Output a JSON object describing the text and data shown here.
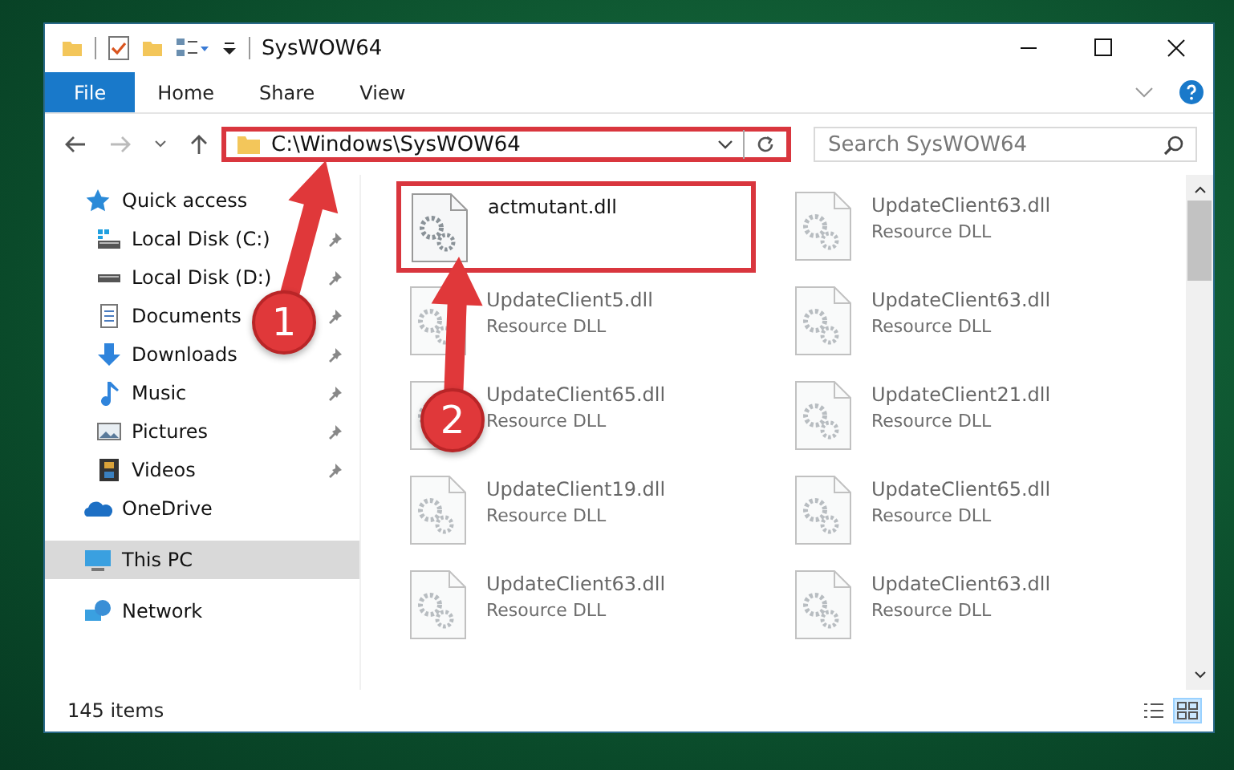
{
  "window": {
    "title": "SysWOW64"
  },
  "ribbon_tabs": [
    {
      "label": "File",
      "selected": true
    },
    {
      "label": "Home",
      "selected": false
    },
    {
      "label": "Share",
      "selected": false
    },
    {
      "label": "View",
      "selected": false
    }
  ],
  "address_bar": {
    "path": "C:\\Windows\\SysWOW64",
    "highlighted": true
  },
  "search": {
    "placeholder": "Search SysWOW64"
  },
  "nav_pane": [
    {
      "label": "Quick access",
      "kind": "quick-access",
      "selected": false,
      "children": [
        {
          "label": "Local Disk (C:)",
          "kind": "disk-c",
          "pinned": true,
          "selected": false
        },
        {
          "label": "Local Disk (D:)",
          "kind": "disk",
          "pinned": true,
          "selected": false
        },
        {
          "label": "Documents",
          "kind": "documents",
          "pinned": true,
          "selected": false
        },
        {
          "label": "Downloads",
          "kind": "downloads",
          "pinned": true,
          "selected": false
        },
        {
          "label": "Music",
          "kind": "music",
          "pinned": true,
          "selected": false
        },
        {
          "label": "Pictures",
          "kind": "pictures",
          "pinned": true,
          "selected": false
        },
        {
          "label": "Videos",
          "kind": "videos",
          "pinned": true,
          "selected": false
        }
      ]
    },
    {
      "label": "OneDrive",
      "kind": "onedrive",
      "selected": false
    },
    {
      "label": "This PC",
      "kind": "pc",
      "selected": true
    },
    {
      "label": "Network",
      "kind": "network",
      "selected": false
    }
  ],
  "files": [
    {
      "name": "actmutant.dll",
      "highlighted": true,
      "blurred": false
    },
    {
      "name": "UpdateClient63.dll",
      "type": "Resource DLL",
      "highlighted": false,
      "blurred": true
    },
    {
      "name": "UpdateClient5.dll",
      "type": "Resource DLL",
      "highlighted": false,
      "blurred": true
    },
    {
      "name": "UpdateClient63.dll",
      "type": "Resource DLL",
      "highlighted": false,
      "blurred": true
    },
    {
      "name": "UpdateClient65.dll",
      "type": "Resource DLL",
      "highlighted": false,
      "blurred": true
    },
    {
      "name": "UpdateClient21.dll",
      "type": "Resource DLL",
      "highlighted": false,
      "blurred": true
    },
    {
      "name": "UpdateClient19.dll",
      "type": "Resource DLL",
      "highlighted": false,
      "blurred": true
    },
    {
      "name": "UpdateClient65.dll",
      "type": "Resource DLL",
      "highlighted": false,
      "blurred": true
    },
    {
      "name": "UpdateClient63.dll",
      "type": "Resource DLL",
      "highlighted": false,
      "blurred": true
    },
    {
      "name": "UpdateClient63.dll",
      "type": "Resource DLL",
      "highlighted": false,
      "blurred": true
    }
  ],
  "status_bar": {
    "item_count": "145 items"
  },
  "callouts": [
    {
      "number": "1"
    },
    {
      "number": "2"
    }
  ]
}
